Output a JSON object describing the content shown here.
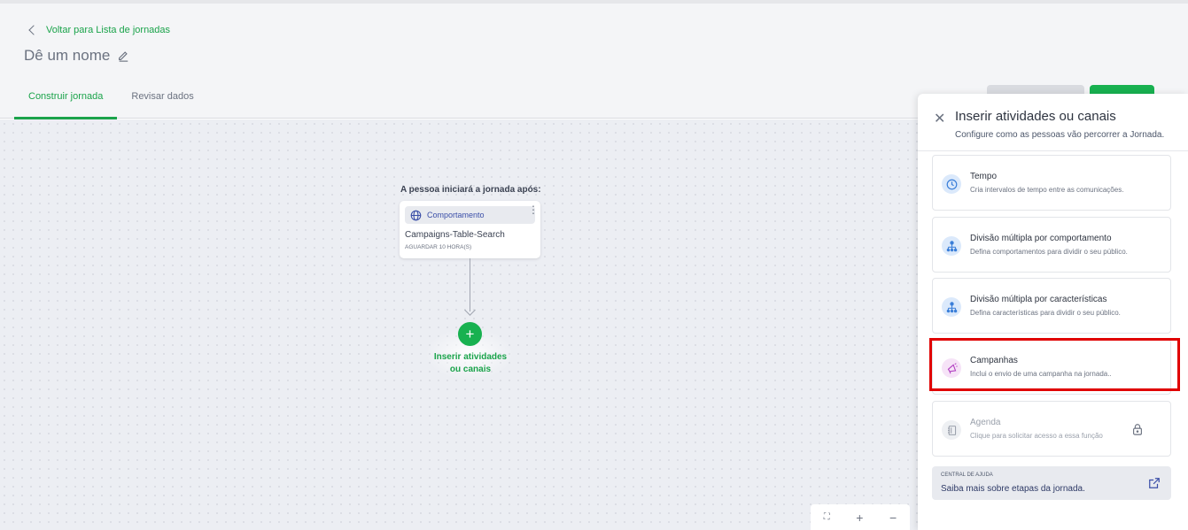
{
  "header": {
    "back_label": "Voltar para Lista de jornadas",
    "journey_name": "Dê um nome",
    "tabs": [
      {
        "label": "Construir jornada",
        "active": true
      },
      {
        "label": "Revisar dados",
        "active": false
      }
    ]
  },
  "canvas": {
    "start_label": "A pessoa iniciará a jornada após:",
    "trigger_node": {
      "tag": "Comportamento",
      "title": "Campaigns-Table-Search",
      "subtitle": "AGUARDAR 10 HORA(S)"
    },
    "add_button": {
      "symbol": "+",
      "label_line1": "Inserir atividades",
      "label_line2": "ou canais"
    },
    "zoom": {
      "fit": "⛶",
      "plus": "+",
      "minus": "−"
    }
  },
  "panel": {
    "title": "Inserir atividades ou canais",
    "subtitle": "Configure como as pessoas vão percorrer a Jornada.",
    "options": [
      {
        "title": "Tempo",
        "description": "Cria intervalos de tempo entre as comunicações.",
        "icon": "clock-icon",
        "locked": false
      },
      {
        "title": "Divisão múltipla por comportamento",
        "description": "Defina comportamentos para dividir o seu público.",
        "icon": "split-icon",
        "locked": false
      },
      {
        "title": "Divisão múltipla por características",
        "description": "Defina características para dividir o seu público.",
        "icon": "split-icon",
        "locked": false
      },
      {
        "title": "Campanhas",
        "description": "Inclui o envio de uma campanha na jornada..",
        "icon": "megaphone-icon",
        "locked": false
      },
      {
        "title": "Agenda",
        "description": "Clique para solicitar acesso a essa função",
        "icon": "agenda-icon",
        "locked": true
      }
    ],
    "help": {
      "tag": "CENTRAL DE AJUDA",
      "text": "Saiba mais sobre etapas da jornada."
    }
  },
  "colors": {
    "accent": "#18b150",
    "highlight": "#e00000",
    "icon_bg": "#dbe9fb"
  }
}
